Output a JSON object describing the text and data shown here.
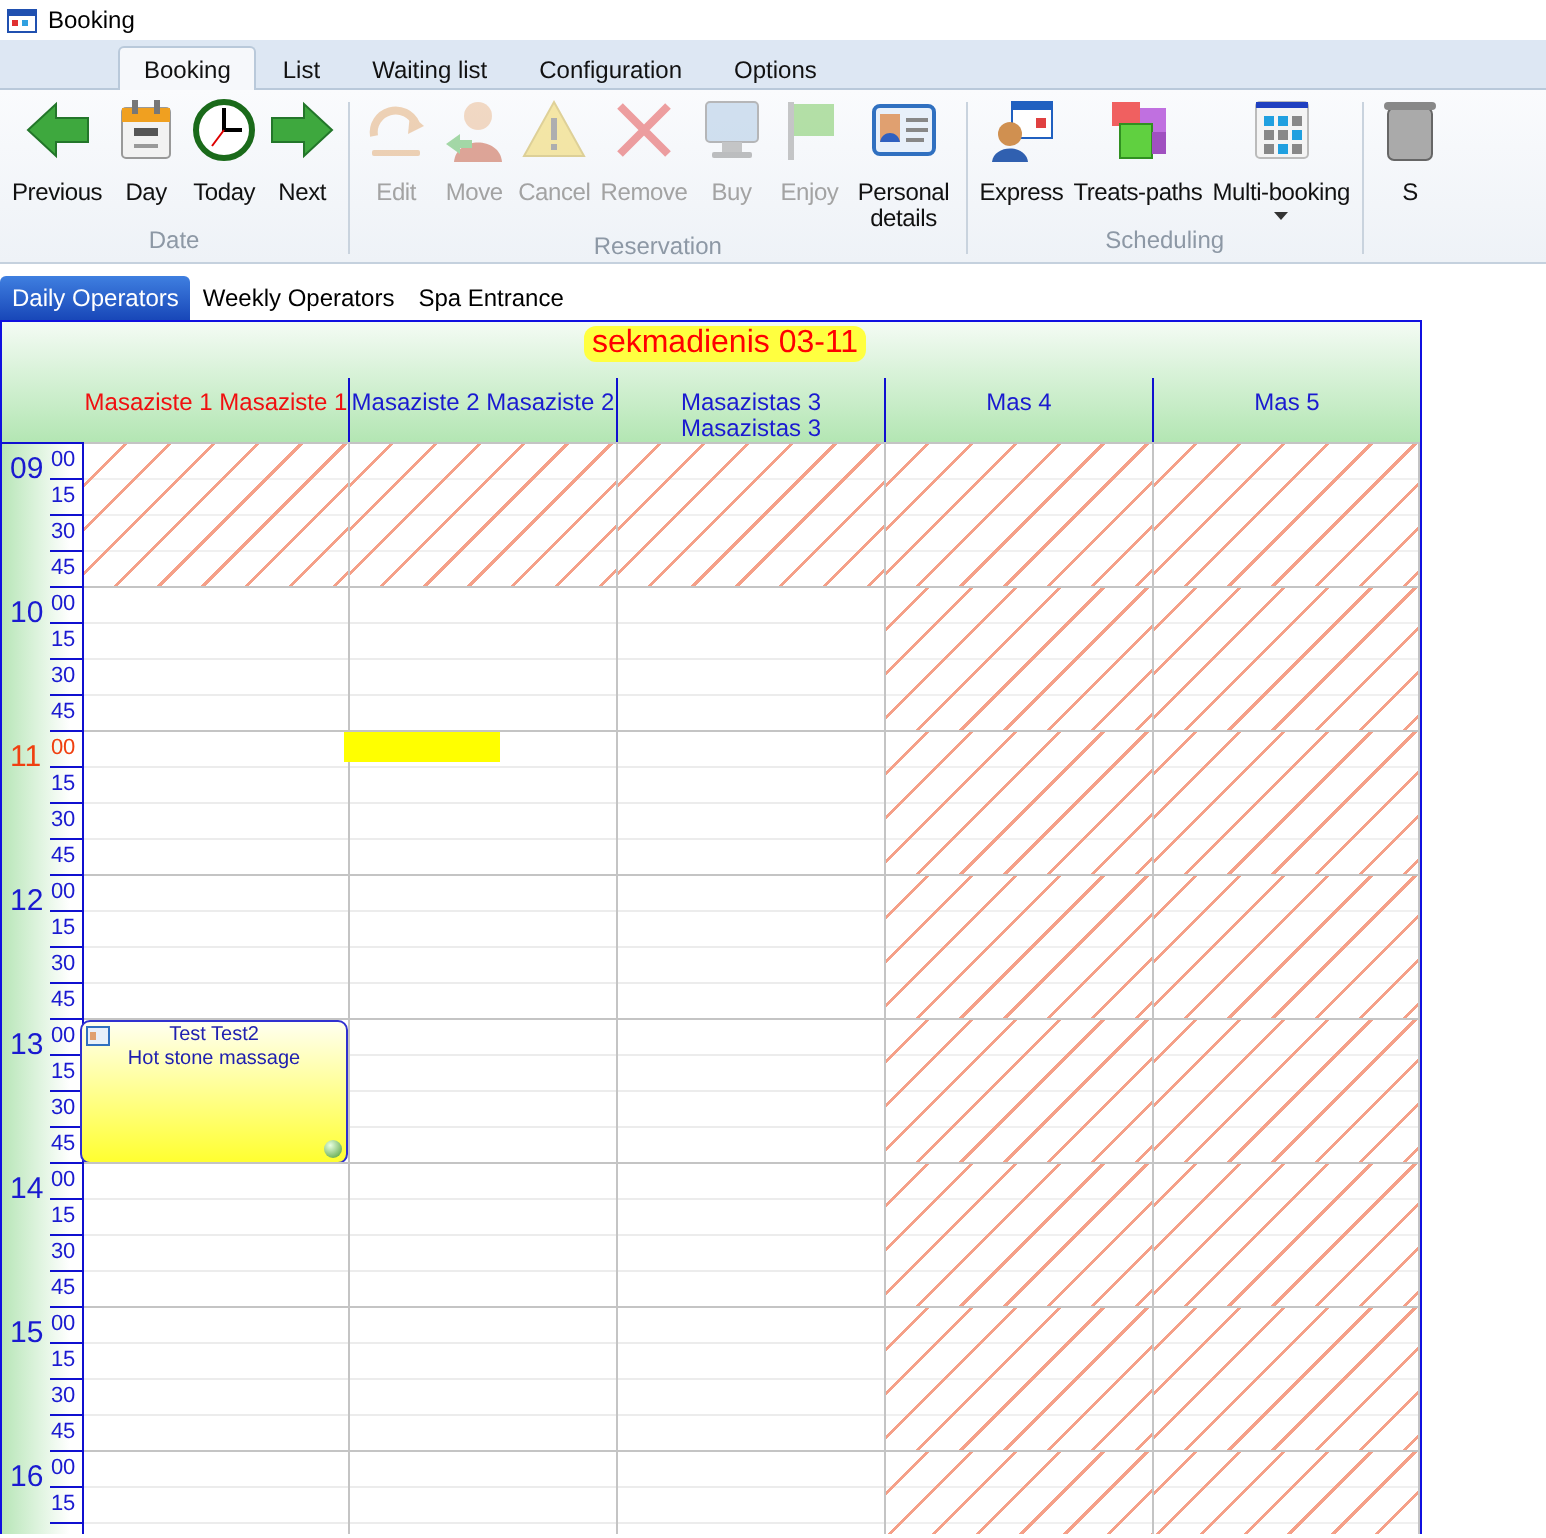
{
  "window": {
    "title": "Booking"
  },
  "ribbon_tabs": [
    {
      "label": "Booking",
      "selected": true
    },
    {
      "label": "List",
      "selected": false
    },
    {
      "label": "Waiting list",
      "selected": false
    },
    {
      "label": "Configuration",
      "selected": false
    },
    {
      "label": "Options",
      "selected": false
    }
  ],
  "ribbon_groups": [
    {
      "label": "Date",
      "buttons": [
        {
          "label": "Previous",
          "kind": "left",
          "disabled": false
        },
        {
          "label": "Day",
          "kind": "calendar",
          "disabled": false
        },
        {
          "label": "Today",
          "kind": "clock",
          "disabled": false
        },
        {
          "label": "Next",
          "kind": "right",
          "disabled": false
        }
      ]
    },
    {
      "label": "Reservation",
      "buttons": [
        {
          "label": "Edit",
          "kind": "edit",
          "disabled": true
        },
        {
          "label": "Move",
          "kind": "person",
          "disabled": true
        },
        {
          "label": "Cancel",
          "kind": "warning",
          "disabled": true
        },
        {
          "label": "Remove",
          "kind": "cross",
          "disabled": true
        },
        {
          "label": "Buy",
          "kind": "monitor",
          "disabled": true
        },
        {
          "label": "Enjoy",
          "kind": "flag",
          "disabled": true
        },
        {
          "label": "Personal details",
          "kind": "card",
          "disabled": false
        }
      ]
    },
    {
      "label": "Scheduling",
      "buttons": [
        {
          "label": "Express",
          "kind": "express",
          "disabled": false
        },
        {
          "label": "Treats-paths",
          "kind": "cubes",
          "disabled": false
        },
        {
          "label": "Multi-booking",
          "kind": "grid",
          "disabled": false,
          "dropdown": true
        }
      ]
    },
    {
      "buttons": [
        {
          "label": "S",
          "kind": "bin",
          "disabled": false
        }
      ]
    }
  ],
  "view_tabs": [
    {
      "label": "Daily Operators",
      "selected": true
    },
    {
      "label": "Weekly Operators",
      "selected": false
    },
    {
      "label": "Spa Entrance",
      "selected": false
    }
  ],
  "calendar": {
    "date_title": "sekmadienis 03-11",
    "columns": [
      {
        "name": "Masaziste 1 Masaziste 1",
        "current": true
      },
      {
        "name": "Masaziste 2 Masaziste 2",
        "current": false
      },
      {
        "name": "Masazistas 3 Masazistas 3",
        "current": false
      },
      {
        "name": "Mas 4",
        "current": false
      },
      {
        "name": "Mas 5",
        "current": false
      }
    ],
    "hours": [
      {
        "hour": "09",
        "current": false,
        "minutes": [
          "00",
          "15",
          "30",
          "45"
        ],
        "cells": [
          {
            "unavailable": true
          },
          {
            "unavailable": true
          },
          {
            "unavailable": true
          },
          {
            "unavailable": true
          },
          {
            "unavailable": true
          }
        ]
      },
      {
        "hour": "10",
        "current": false,
        "minutes": [
          "00",
          "15",
          "30",
          "45"
        ],
        "cells": [
          {
            "unavailable": false
          },
          {
            "unavailable": false
          },
          {
            "unavailable": false
          },
          {
            "unavailable": true
          },
          {
            "unavailable": true
          }
        ]
      },
      {
        "hour": "11",
        "current": true,
        "minutes": [
          "00",
          "15",
          "30",
          "45"
        ],
        "cells": [
          {
            "unavailable": false
          },
          {
            "unavailable": false,
            "highlight": true
          },
          {
            "unavailable": false
          },
          {
            "unavailable": true
          },
          {
            "unavailable": true
          }
        ]
      },
      {
        "hour": "12",
        "current": false,
        "minutes": [
          "00",
          "15",
          "30",
          "45"
        ],
        "cells": [
          {
            "unavailable": false
          },
          {
            "unavailable": false
          },
          {
            "unavailable": false
          },
          {
            "unavailable": true
          },
          {
            "unavailable": true
          }
        ]
      },
      {
        "hour": "13",
        "current": false,
        "minutes": [
          "00",
          "15",
          "30",
          "45"
        ],
        "cells": [
          {
            "unavailable": false,
            "appointment": {
              "client": "Test Test2",
              "service": "Hot stone massage"
            }
          },
          {
            "unavailable": false
          },
          {
            "unavailable": false
          },
          {
            "unavailable": true
          },
          {
            "unavailable": true
          }
        ]
      },
      {
        "hour": "14",
        "current": false,
        "minutes": [
          "00",
          "15",
          "30",
          "45"
        ],
        "cells": [
          {
            "unavailable": false
          },
          {
            "unavailable": false
          },
          {
            "unavailable": false
          },
          {
            "unavailable": true
          },
          {
            "unavailable": true
          }
        ]
      },
      {
        "hour": "15",
        "current": false,
        "minutes": [
          "00",
          "15",
          "30",
          "45"
        ],
        "cells": [
          {
            "unavailable": false
          },
          {
            "unavailable": false
          },
          {
            "unavailable": false
          },
          {
            "unavailable": true
          },
          {
            "unavailable": true
          }
        ]
      },
      {
        "hour": "16",
        "current": false,
        "minutes": [
          "00",
          "15"
        ],
        "cells": [
          {
            "unavailable": false
          },
          {
            "unavailable": false
          },
          {
            "unavailable": false
          },
          {
            "unavailable": true
          },
          {
            "unavailable": true
          }
        ]
      }
    ]
  }
}
